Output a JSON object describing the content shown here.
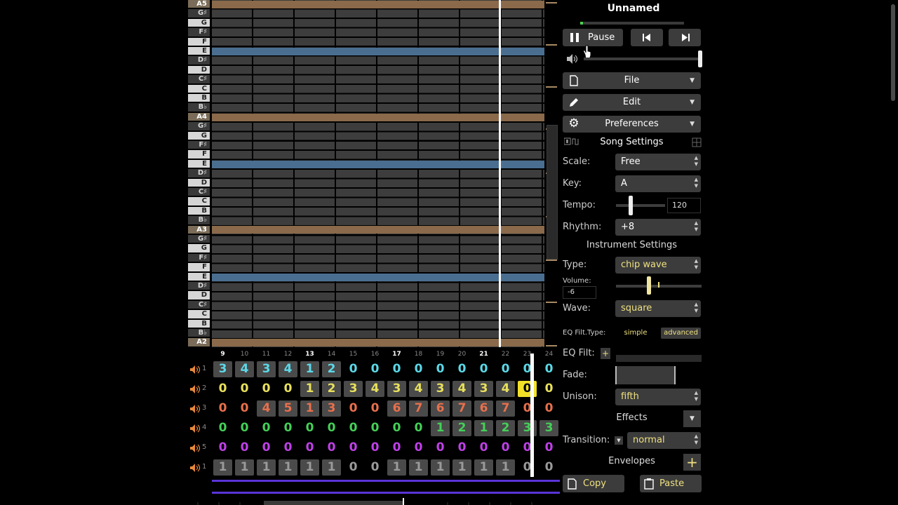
{
  "song": {
    "title": "Unnamed"
  },
  "transport": {
    "play_label": "Pause"
  },
  "menus": {
    "file": "File",
    "edit": "Edit",
    "preferences": "Preferences"
  },
  "song_settings": {
    "heading": "Song Settings",
    "scale_label": "Scale:",
    "scale_value": "Free",
    "key_label": "Key:",
    "key_value": "A",
    "tempo_label": "Tempo:",
    "tempo_value": "120",
    "rhythm_label": "Rhythm:",
    "rhythm_value": "+8"
  },
  "instrument_settings": {
    "heading": "Instrument Settings",
    "type_label": "Type:",
    "type_value": "chip wave",
    "volume_label": "Volume:",
    "volume_value": "-6",
    "wave_label": "Wave:",
    "wave_value": "square",
    "eq_type_label": "EQ Filt.Type:",
    "eq_simple": "simple",
    "eq_advanced": "advanced",
    "eq_filt_label": "EQ Filt:",
    "eq_add": "+",
    "fade_label": "Fade:",
    "unison_label": "Unison:",
    "unison_value": "fifth",
    "effects_label": "Effects",
    "transition_label": "Transition:",
    "transition_value": "normal",
    "envelopes_label": "Envelopes",
    "envelopes_add": "+"
  },
  "clipboard": {
    "copy": "Copy",
    "paste": "Paste"
  },
  "piano_keys": [
    "A5",
    "G♯",
    "G",
    "F♯",
    "F",
    "E",
    "D♯",
    "D",
    "C♯",
    "C",
    "B",
    "B♭",
    "A4",
    "G♯",
    "G",
    "F♯",
    "F",
    "E",
    "D♯",
    "D",
    "C♯",
    "C",
    "B",
    "B♭",
    "A3",
    "G♯",
    "G",
    "F♯",
    "F",
    "E",
    "D♯",
    "D",
    "C♯",
    "C",
    "B",
    "B♭",
    "A2"
  ],
  "bar_numbers": [
    "9",
    "10",
    "11",
    "12",
    "13",
    "14",
    "15",
    "16",
    "17",
    "18",
    "19",
    "20",
    "21",
    "22",
    "23",
    "24"
  ],
  "bold_bars": [
    "9",
    "13",
    "17",
    "21"
  ],
  "channels": [
    {
      "num": "1",
      "color": "#5cd8e8",
      "patterns": [
        "3",
        "4",
        "3",
        "4",
        "1",
        "2",
        "0",
        "0",
        "0",
        "0",
        "0",
        "0",
        "0",
        "0",
        "0",
        "0"
      ]
    },
    {
      "num": "2",
      "color": "#e8e05c",
      "patterns": [
        "0",
        "0",
        "0",
        "0",
        "1",
        "2",
        "3",
        "4",
        "3",
        "4",
        "3",
        "4",
        "3",
        "4",
        "0",
        "0"
      ]
    },
    {
      "num": "3",
      "color": "#e8704c",
      "patterns": [
        "0",
        "0",
        "4",
        "5",
        "1",
        "3",
        "0",
        "0",
        "6",
        "7",
        "6",
        "7",
        "6",
        "7",
        "0",
        "0"
      ]
    },
    {
      "num": "4",
      "color": "#44d058",
      "patterns": [
        "0",
        "0",
        "0",
        "0",
        "0",
        "0",
        "0",
        "0",
        "0",
        "0",
        "1",
        "2",
        "1",
        "2",
        "3",
        "3"
      ]
    },
    {
      "num": "5",
      "color": "#c040e8",
      "patterns": [
        "0",
        "0",
        "0",
        "0",
        "0",
        "0",
        "0",
        "0",
        "0",
        "0",
        "0",
        "0",
        "0",
        "0",
        "0",
        "0"
      ]
    },
    {
      "num": "1",
      "color": "#9a9a9a",
      "patterns": [
        "1",
        "1",
        "1",
        "1",
        "1",
        "1",
        "0",
        "0",
        "1",
        "1",
        "1",
        "1",
        "1",
        "1",
        "0",
        "0"
      ]
    }
  ],
  "selected_cell": {
    "channel": 2,
    "bar": "23"
  },
  "colors": {
    "tonic_row": "#8a6a4a",
    "fifth_row": "#4a6e90",
    "accent_purple": "#5a34d8",
    "selection": "#f2e028"
  }
}
